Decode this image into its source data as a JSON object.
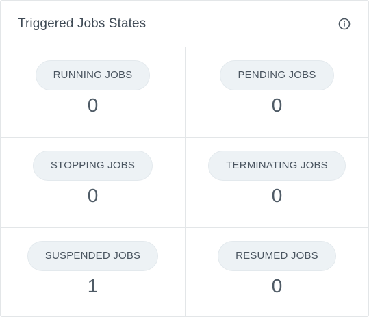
{
  "widget": {
    "title": "Triggered Jobs States",
    "info_icon": "info-circle-icon"
  },
  "states": [
    {
      "label": "RUNNING JOBS",
      "count": "0"
    },
    {
      "label": "PENDING JOBS",
      "count": "0"
    },
    {
      "label": "STOPPING JOBS",
      "count": "0"
    },
    {
      "label": "TERMINATING JOBS",
      "count": "0"
    },
    {
      "label": "SUSPENDED JOBS",
      "count": "1"
    },
    {
      "label": "RESUMED JOBS",
      "count": "0"
    }
  ],
  "colors": {
    "border": "#e3e6e8",
    "pill_bg": "#edf2f5",
    "text": "#3f4a55"
  }
}
